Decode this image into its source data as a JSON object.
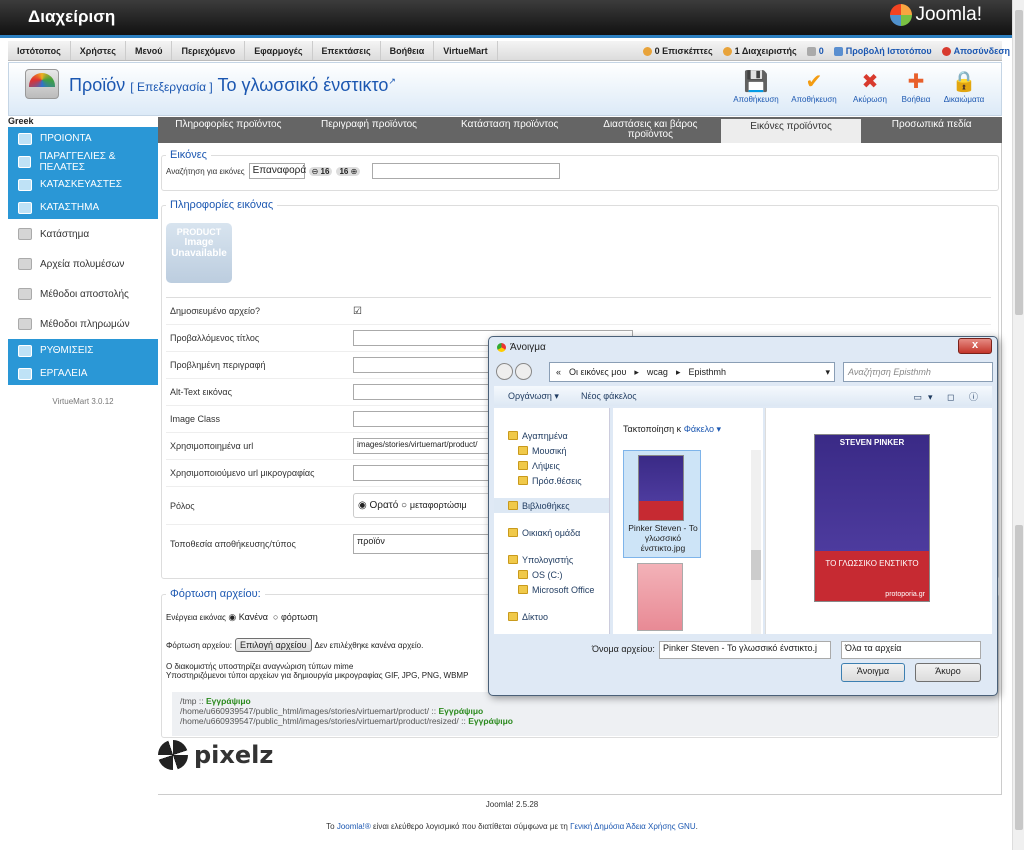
{
  "header": {
    "title": "Διαχείριση",
    "logo_text": "Joomla!"
  },
  "menu": [
    "Ιστότοπος",
    "Χρήστες",
    "Μενού",
    "Περιεχόμενο",
    "Εφαρμογές",
    "Επεκτάσεις",
    "Βοήθεια",
    "VirtueMart"
  ],
  "status": {
    "visitors": "0 Επισκέπτες",
    "admins": "1 Διαχειριστής",
    "messages": "0",
    "view_site": "Προβολή Ιστοτόπου",
    "logout": "Αποσύνδεση"
  },
  "page": {
    "title": "Προϊόν",
    "mode": "[ Επεξεργασία ]",
    "product": "Το γλωσσικό ένστικτο"
  },
  "toolbar": [
    {
      "label": "Αποθήκευση",
      "icon": "floppy-icon",
      "glyph": "💾",
      "color": "#555"
    },
    {
      "label": "Αποθήκευση",
      "icon": "check-icon",
      "glyph": "✔",
      "color": "#f39c12"
    },
    {
      "label": "Ακύρωση",
      "icon": "cancel-icon",
      "glyph": "✖",
      "color": "#d83a2e"
    },
    {
      "label": "Βοήθεια",
      "icon": "lifebuoy-icon",
      "glyph": "✚",
      "color": "#e8602c"
    },
    {
      "label": "Δικαιώματα",
      "icon": "lock-icon",
      "glyph": "🔒",
      "color": "#999"
    }
  ],
  "sidebar": {
    "lang": "Greek",
    "items": [
      {
        "label": "ΠΡΟΙΟΝΤΑ",
        "type": "hl"
      },
      {
        "label": "ΠΑΡΑΓΓΕΛΙΕΣ & ΠΕΛΑΤΕΣ",
        "type": "hl"
      },
      {
        "label": "ΚΑΤΑΣΚΕΥΑΣΤΕΣ",
        "type": "hl"
      },
      {
        "label": "ΚΑΤΑΣΤΗΜΑ",
        "type": "hl"
      },
      {
        "label": "Κατάστημα",
        "type": "wh"
      },
      {
        "label": "Αρχεία πολυμέσων",
        "type": "wh"
      },
      {
        "label": "Μέθοδοι αποστολής",
        "type": "wh"
      },
      {
        "label": "Μέθοδοι πληρωμών",
        "type": "wh"
      },
      {
        "label": "ΡΥΘΜΙΣΕΙΣ",
        "type": "hl"
      },
      {
        "label": "ΕΡΓΑΛΕΙΑ",
        "type": "hl"
      }
    ],
    "version": "VirtueMart 3.0.12"
  },
  "tabs": [
    "Πληροφορίες προϊόντος",
    "Περιγραφή προϊόντος",
    "Κατάσταση προϊόντος",
    "Διαστάσεις και βάρος προϊόντος",
    "Εικόνες προϊόντος",
    "Προσωπικά πεδία"
  ],
  "images": {
    "legend": "Εικόνες",
    "search_label": "Αναζήτηση για εικόνες",
    "search_value": "Επαναφορά",
    "count1": "16",
    "count2": "16"
  },
  "info": {
    "legend": "Πληροφορίες εικόνας",
    "placeholder_lines": [
      "PRODUCT",
      "Image",
      "Unavailable"
    ],
    "rows": {
      "published": "Δημοσιευμένο αρχείο?",
      "title": "Προβαλλόμενος τίτλος",
      "desc": "Προβλημένη περιγραφή",
      "alt": "Alt-Text εικόνας",
      "cls": "Image Class",
      "url": "Χρησιμοποιημένα url",
      "url_value": "images/stories/virtuemart/product/",
      "thumb": "Χρησιμοποιούμενο url μικρογραφίας",
      "role": "Ρόλος",
      "role_opt1": "Ορατό",
      "role_opt2": "μεταφορτώσιμ",
      "location": "Τοποθεσία αποθήκευσης/τύπος",
      "location_value": "προϊόν"
    }
  },
  "upload": {
    "legend": "Φόρτωση αρχείου:",
    "action_label": "Ενέργεια εικόνας",
    "opt1": "Κανένα",
    "opt2": "φόρτωση",
    "file_label": "Φόρτωση αρχείου:",
    "choose_btn": "Επιλογή αρχείου",
    "no_file": "Δεν επιλέχθηκε κανένα αρχείο.",
    "mime1": "Ο διακομιστής υποστηρίζει αναγνώριση τύπων mime",
    "mime2": "Υποστηριζόμενοι τύποι αρχείων για δημιουργία μικρογραφίας GIF, JPG, PNG, WBMP"
  },
  "paths": [
    {
      "path": "/tmp",
      "state": "Εγγράψιμο"
    },
    {
      "path": "/home/u660939547/public_html/images/stories/virtuemart/product/",
      "state": "Εγγράψιμο"
    },
    {
      "path": "/home/u660939547/public_html/images/stories/virtuemart/product/resized/",
      "state": "Εγγράψιμο"
    }
  ],
  "brand": "pixelz",
  "dialog": {
    "title": "Άνοιγμα",
    "close": "x",
    "crumb": [
      "Οι εικόνες μου",
      "wcag",
      "Episthmh"
    ],
    "search": "Αναζήτηση Episthmh",
    "organize": "Οργάνωση",
    "new_folder": "Νέος φάκελος",
    "nav": [
      {
        "label": "Αγαπημένα",
        "sub": false,
        "icon": "star-icon"
      },
      {
        "label": "Μουσική",
        "sub": true,
        "icon": "music-icon"
      },
      {
        "label": "Λήψεις",
        "sub": true,
        "icon": "folder-icon"
      },
      {
        "label": "Πρόσ.θέσεις",
        "sub": true,
        "icon": "folder-icon"
      },
      {
        "label": "Βιβλιοθήκες",
        "sub": false,
        "icon": "library-icon"
      },
      {
        "label": "Οικιακή ομάδα",
        "sub": false,
        "icon": "group-icon"
      },
      {
        "label": "Υπολογιστής",
        "sub": false,
        "icon": "computer-icon"
      },
      {
        "label": "OS (C:)",
        "sub": true,
        "icon": "drive-icon"
      },
      {
        "label": "Microsoft Office",
        "sub": true,
        "icon": "drive-icon"
      },
      {
        "label": "Δίκτυο",
        "sub": false,
        "icon": "network-icon"
      }
    ],
    "sort_label": "Τακτοποίηση κ",
    "sort_value": "Φάκελο",
    "file_name": "Pinker Steven - Το γλωσσικό ένστικτο.jpg",
    "book_author": "STEVEN PINKER",
    "book_title": "ΤΟ ΓΛΩΣΣΙΚΟ ΕΝΣΤΙΚΤΟ",
    "book_sub": "protoporia.gr",
    "filename_label": "Όνομα αρχείου:",
    "filename_value": "Pinker Steven - Το γλωσσικό ένστικτο.j",
    "filetype": "Όλα τα αρχεία",
    "open": "Άνοιγμα",
    "cancel": "Άκυρο"
  },
  "footer": {
    "version": "Joomla! 2.5.28",
    "lic_pre": "Το ",
    "lic_link1": "Joomla!®",
    "lic_mid": " είναι ελεύθερο λογισμικό που διατίθεται σύμφωνα με τη ",
    "lic_link2": "Γενική Δημόσια Άδεια Χρήσης GNU",
    "lic_end": "."
  }
}
